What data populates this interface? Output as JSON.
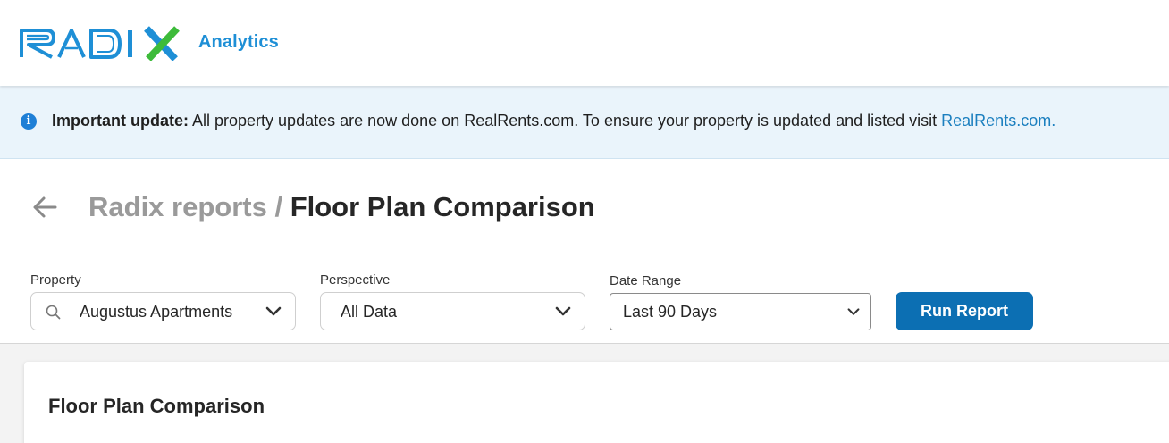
{
  "header": {
    "logo_text": "RADIX",
    "product_name": "Analytics",
    "colors": {
      "logo_blue": "#1e8fd6",
      "logo_green": "#3dbb3a"
    }
  },
  "banner": {
    "icon": "info-icon",
    "title": "Important update:",
    "message": " All property updates are now done on RealRents.com. To ensure your property is updated and listed visit ",
    "link_text": "RealRents.com."
  },
  "breadcrumb": {
    "back_icon": "arrow-left-icon",
    "parent": "Radix reports",
    "separator": " / ",
    "current": "Floor Plan Comparison"
  },
  "filters": {
    "property": {
      "label": "Property",
      "value": "Augustus Apartments",
      "icon": "search-icon"
    },
    "perspective": {
      "label": "Perspective",
      "value": "All Data"
    },
    "date_range": {
      "label": "Date Range",
      "value": "Last 90 Days"
    },
    "run_button": "Run Report"
  },
  "report": {
    "title": "Floor Plan Comparison"
  },
  "colors": {
    "primary_button": "#0c6fb3",
    "link": "#1b7fbf",
    "banner_bg": "#eaf4fb"
  }
}
